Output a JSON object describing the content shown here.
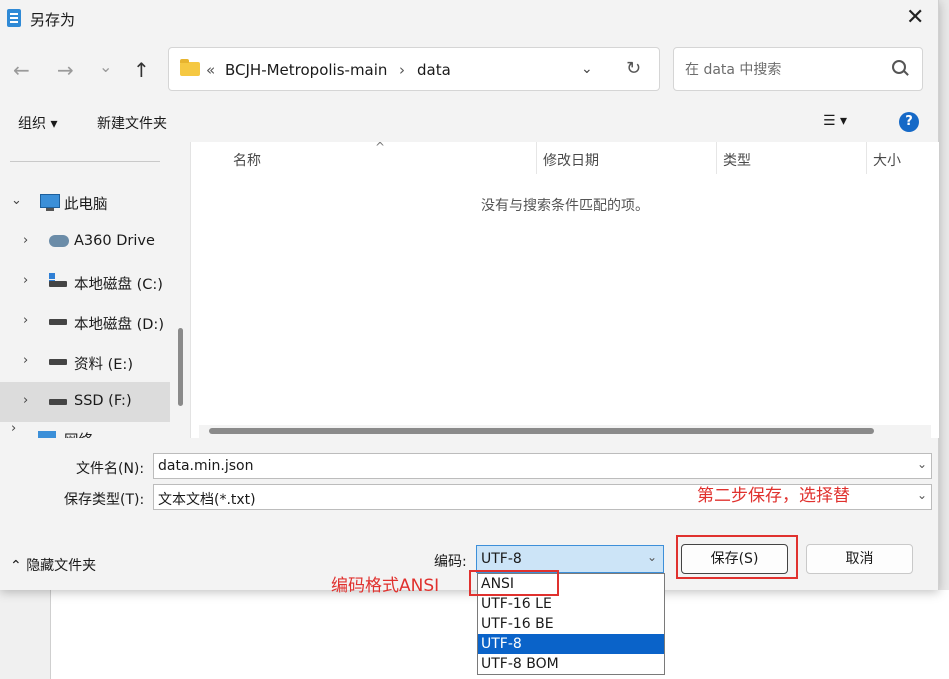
{
  "window": {
    "title": "另存为"
  },
  "nav": {
    "back": "←",
    "forward": "→",
    "recent": "⌄",
    "up": "↑"
  },
  "address": {
    "sep1": "«",
    "crumbs": [
      "BCJH-Metropolis-main",
      "data"
    ],
    "sep2": "›"
  },
  "search": {
    "placeholder": "在 data 中搜索"
  },
  "commands": {
    "organize": "组织 ▾",
    "new_folder": "新建文件夹",
    "view": "☰ ▾",
    "help": "?"
  },
  "sidebar": {
    "items": [
      {
        "label": "此电脑",
        "icon": "computer-icon"
      },
      {
        "label": "A360 Drive",
        "icon": "cloud-drive-icon"
      },
      {
        "label": "本地磁盘 (C:)",
        "icon": "windows-drive-icon"
      },
      {
        "label": "本地磁盘 (D:)",
        "icon": "drive-icon"
      },
      {
        "label": "资料 (E:)",
        "icon": "drive-icon"
      },
      {
        "label": "SSD (F:)",
        "icon": "drive-icon",
        "selected": true
      },
      {
        "label": "网络",
        "icon": "network-icon"
      }
    ]
  },
  "columns": [
    "名称",
    "修改日期",
    "类型",
    "大小"
  ],
  "empty_message": "没有与搜索条件匹配的项。",
  "form": {
    "filename_label": "文件名(N):",
    "filename_value": "data.min.json",
    "filetype_label": "保存类型(T):",
    "filetype_value": "文本文档(*.txt)",
    "hide_folders": "隐藏文件夹",
    "encoding_label": "编码:",
    "encoding_value": "UTF-8",
    "save": "保存(S)",
    "cancel": "取消"
  },
  "encoding_options": [
    {
      "label": "ANSI",
      "selected": false
    },
    {
      "label": "UTF-16 LE",
      "selected": false
    },
    {
      "label": "UTF-16 BE",
      "selected": false
    },
    {
      "label": "UTF-8",
      "selected": true
    },
    {
      "label": "UTF-8 BOM",
      "selected": false
    }
  ],
  "annotations": {
    "step2": "第二步保存，选择替",
    "encoding_hint": "编码格式ANSI",
    "color": "#e0312e"
  }
}
